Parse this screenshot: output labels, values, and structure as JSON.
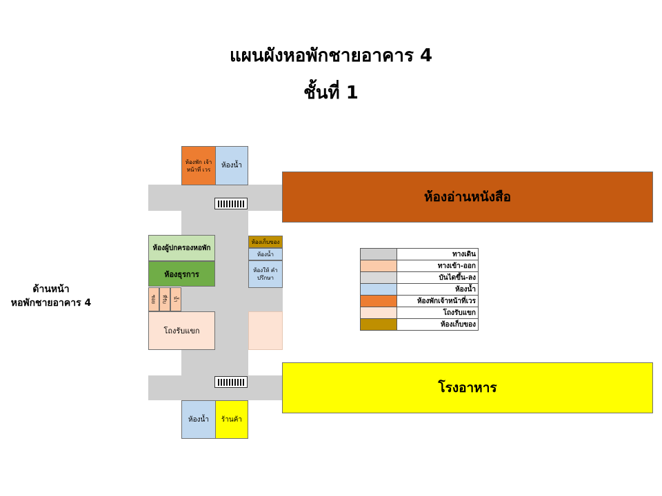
{
  "title": {
    "line1": "แผนผังหอพักชายอาคาร 4",
    "line2": "ชั้นที่ 1"
  },
  "front_label": {
    "line1": "ด้านหน้า",
    "line2": "หอพักชายอาคาร 4"
  },
  "rooms": {
    "staff_rest": "ห้องพัก เจ้าหน้าที่ เวร",
    "toilet_top": "ห้องน้ำ",
    "reading_room": "ห้องอ่านหนังสือ",
    "storage": "ห้องเก็บของ",
    "guardian_room": "ห้องผู้ปกครองหอพัก",
    "business_room": "ห้องธุรการ",
    "toilet_small": "ห้องน้ำ",
    "counseling": "ห้องให้ คำปรึกษา",
    "small_a": "ซอย",
    "small_b": "ที่รับ",
    "small_c": "น้ำ",
    "lobby": "โถงรับแขก",
    "canteen": "โรงอาหาร",
    "toilet_bottom": "ห้องน้ำ",
    "shop": "ร้านค้า"
  },
  "legend": [
    {
      "label": "ทางเดิน",
      "color": "#cfcfcf"
    },
    {
      "label": "ทางเข้า-ออก",
      "color": "#fbcbaa"
    },
    {
      "label": "บันไดขึ้น-ลง",
      "color": "#d9d9d9"
    },
    {
      "label": "ห้องน้ำ",
      "color": "#c0d8ef"
    },
    {
      "label": "ห้องพักเจ้าหน้าที่เวร",
      "color": "#ed7d31"
    },
    {
      "label": "โถงรับแขก",
      "color": "#fde3d4"
    },
    {
      "label": "ห้องเก็บของ",
      "color": "#bf8f00"
    }
  ],
  "colors": {
    "walkway": "#cfcfcf",
    "staff_rest": "#ed7d31",
    "toilet": "#c0d8ef",
    "reading_room": "#c55a11",
    "storage": "#bf8f00",
    "guardian_room": "#c7e2b3",
    "business_room": "#70ad47",
    "lobby": "#fde3d4",
    "entrance": "#fbcbaa",
    "canteen": "#ffff00",
    "shop": "#ffff00"
  }
}
